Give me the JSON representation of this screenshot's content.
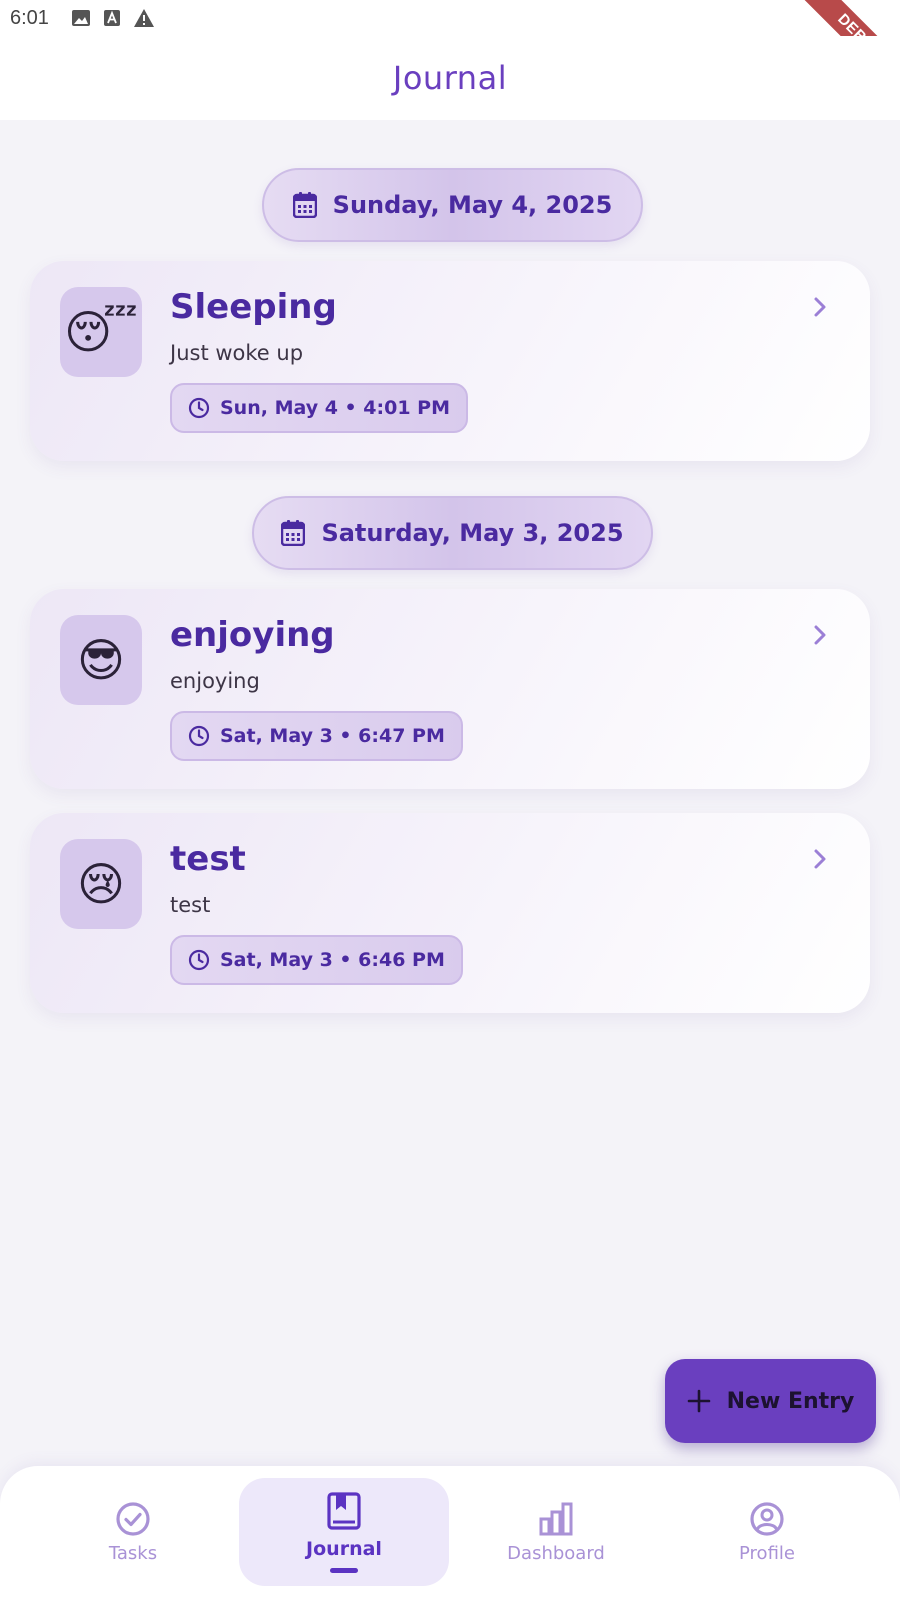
{
  "status_bar": {
    "time": "6:01",
    "icons": [
      "image-icon",
      "font-icon",
      "warning-icon"
    ],
    "debug_label": "DEBUG"
  },
  "app_bar": {
    "title": "Journal"
  },
  "groups": [
    {
      "date_label": "Sunday, May 4, 2025",
      "entries": [
        {
          "emoji": "😴",
          "title": "Sleeping",
          "note": "Just woke up",
          "timestamp": "Sun, May 4 • 4:01 PM"
        }
      ]
    },
    {
      "date_label": "Saturday, May 3, 2025",
      "entries": [
        {
          "emoji": "😎",
          "title": "enjoying",
          "note": "enjoying",
          "timestamp": "Sat, May 3 • 6:47 PM"
        },
        {
          "emoji": "😢",
          "title": "test",
          "note": "test",
          "timestamp": "Sat, May 3 • 6:46 PM"
        }
      ]
    }
  ],
  "fab": {
    "label": "New Entry",
    "icon": "plus-icon"
  },
  "bottom_nav": {
    "items": [
      {
        "label": "Tasks",
        "icon": "check-circle-icon",
        "active": false
      },
      {
        "label": "Journal",
        "icon": "book-icon",
        "active": true
      },
      {
        "label": "Dashboard",
        "icon": "bar-chart-icon",
        "active": false
      },
      {
        "label": "Profile",
        "icon": "account-circle-icon",
        "active": false
      }
    ]
  },
  "colors": {
    "primary": "#6a3fbf",
    "primary_dark": "#4a2aa0",
    "background": "#f4f3f8",
    "pill": "#d3c4ea",
    "inactive_nav": "#a992d6",
    "debug_ribbon": "#b84a4a"
  }
}
